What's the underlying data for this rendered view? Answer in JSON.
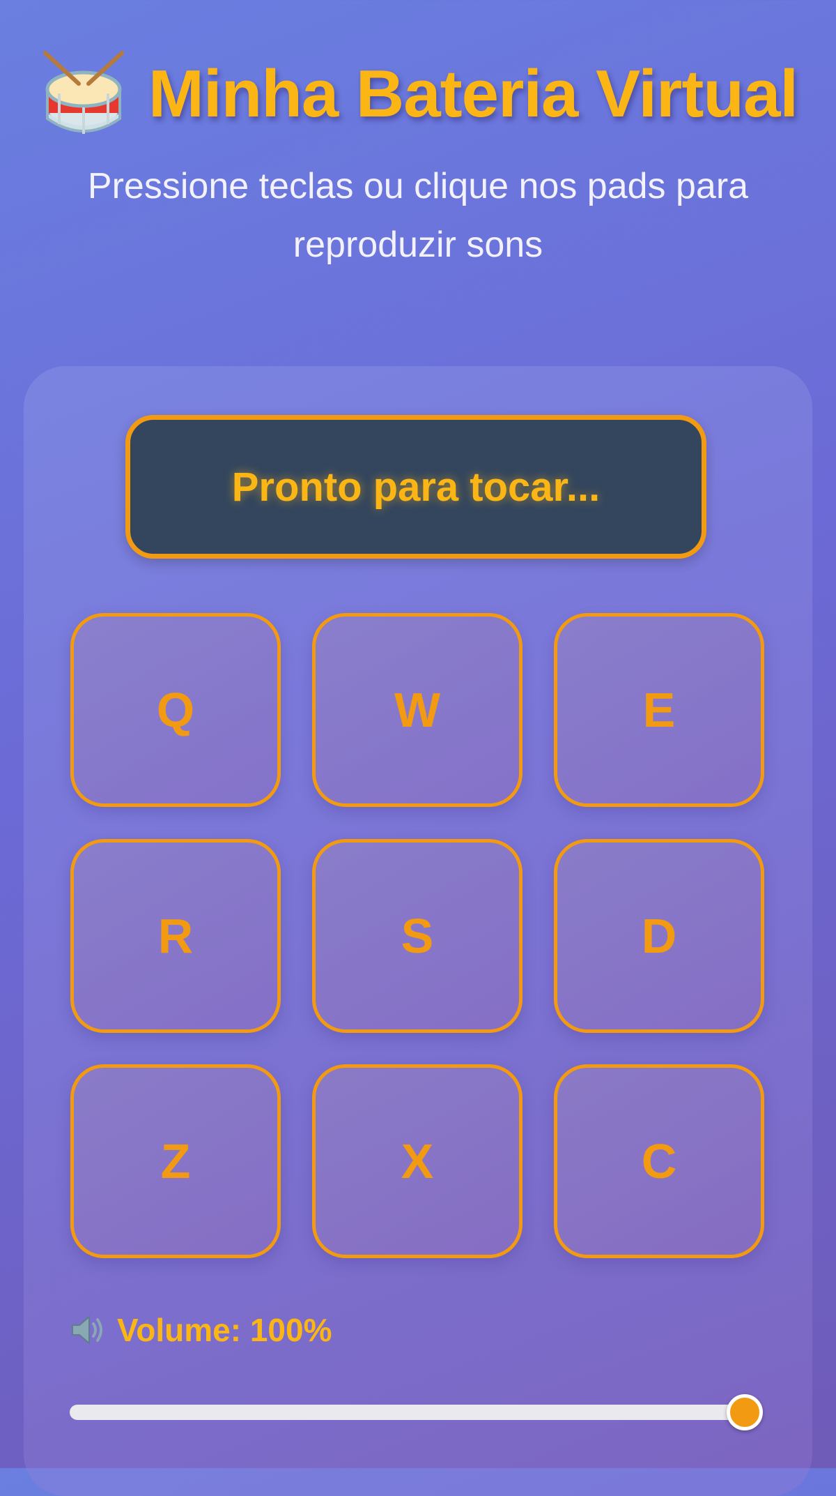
{
  "header": {
    "title": "Minha Bateria Virtual",
    "title_icon": "drum-icon",
    "subtitle": "Pressione teclas ou clique nos pads para reproduzir sons"
  },
  "display": {
    "status_text": "Pronto para tocar..."
  },
  "pads": [
    {
      "key": "Q"
    },
    {
      "key": "W"
    },
    {
      "key": "E"
    },
    {
      "key": "R"
    },
    {
      "key": "S"
    },
    {
      "key": "D"
    },
    {
      "key": "Z"
    },
    {
      "key": "X"
    },
    {
      "key": "C"
    }
  ],
  "volume": {
    "icon": "speaker-icon",
    "label": "Volume: 100%",
    "level": 1.0
  },
  "colors": {
    "accent": "#fbb615",
    "pad_border": "#f29a12",
    "display_bg": "#33465e"
  }
}
